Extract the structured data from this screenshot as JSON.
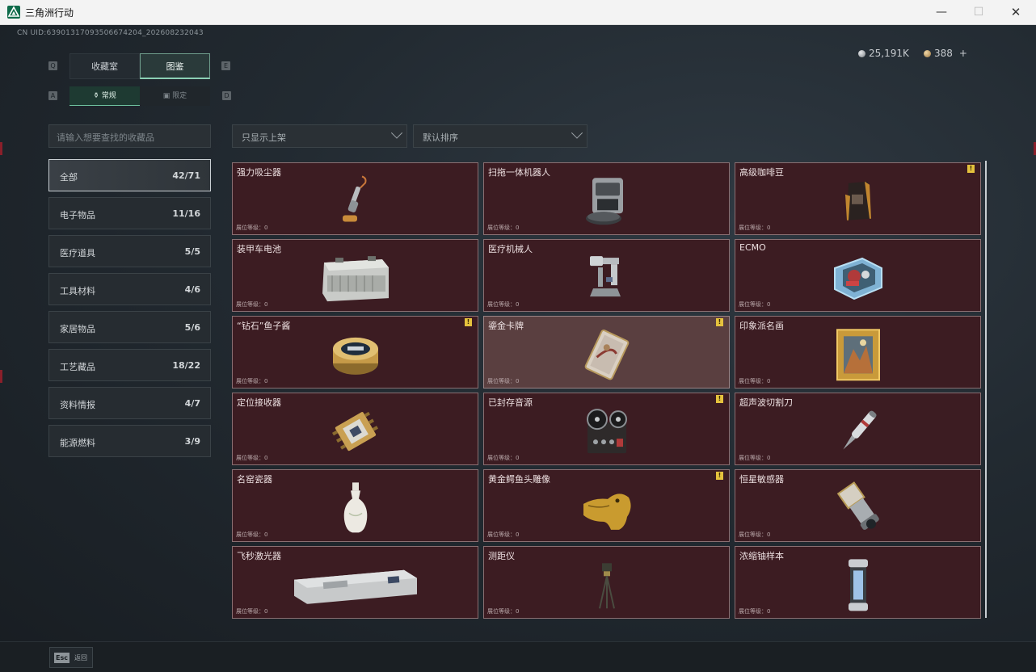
{
  "window": {
    "title": "三角洲行动",
    "minimize": "—",
    "maximize": "☐",
    "close": "✕"
  },
  "uid": "CN UID:63901317093506674204_202608232043",
  "currency": [
    {
      "icon": "silver-coin-icon",
      "value": "25,191K"
    },
    {
      "icon": "gold-coin-icon",
      "value": "388",
      "add": "+"
    }
  ],
  "key_hints": {
    "tab_prev": "Q",
    "tab_next": "E",
    "sub_prev": "A",
    "sub_next": "D"
  },
  "tabs": [
    {
      "label": "收藏室",
      "active": false
    },
    {
      "label": "图鉴",
      "active": true
    }
  ],
  "subtabs": [
    {
      "label": "常规",
      "active": true
    },
    {
      "label": "限定",
      "active": false
    }
  ],
  "search": {
    "placeholder": "请输入想要查找的收藏品"
  },
  "filters": {
    "shelf": "只显示上架",
    "sort": "默认排序"
  },
  "categories": [
    {
      "label": "全部",
      "count": "42/71",
      "active": true
    },
    {
      "label": "电子物品",
      "count": "11/16"
    },
    {
      "label": "医疗道具",
      "count": "5/5"
    },
    {
      "label": "工具材料",
      "count": "4/6"
    },
    {
      "label": "家居物品",
      "count": "5/6"
    },
    {
      "label": "工艺藏品",
      "count": "18/22"
    },
    {
      "label": "资料情报",
      "count": "4/7"
    },
    {
      "label": "能源燃料",
      "count": "3/9"
    }
  ],
  "items": [
    {
      "name": "强力吸尘器",
      "level": "展位等级：0",
      "alert": false,
      "icon": "vacuum-cleaner-icon"
    },
    {
      "name": "扫拖一体机器人",
      "level": "展位等级：0",
      "alert": false,
      "icon": "mop-robot-icon"
    },
    {
      "name": "高级咖啡豆",
      "level": "展位等级：0",
      "alert": true,
      "icon": "coffee-bag-icon"
    },
    {
      "name": "装甲车电池",
      "level": "展位等级：0",
      "alert": false,
      "icon": "vehicle-battery-icon"
    },
    {
      "name": "医疗机械人",
      "level": "展位等级：0",
      "alert": false,
      "icon": "medical-robot-icon"
    },
    {
      "name": "ECMO",
      "level": "展位等级：0",
      "alert": false,
      "icon": "ecmo-machine-icon"
    },
    {
      "name": "“钻石”鱼子酱",
      "level": "展位等级：0",
      "alert": true,
      "icon": "caviar-tin-icon"
    },
    {
      "name": "鎏金卡牌",
      "level": "展位等级：0",
      "alert": true,
      "highlight": true,
      "icon": "gilded-card-icon"
    },
    {
      "name": "印象派名画",
      "level": "展位等级：0",
      "alert": false,
      "icon": "framed-painting-icon"
    },
    {
      "name": "定位接收器",
      "level": "展位等级：0",
      "alert": false,
      "icon": "gps-receiver-icon"
    },
    {
      "name": "已封存音源",
      "level": "展位等级：0",
      "alert": true,
      "icon": "tape-recorder-icon"
    },
    {
      "name": "超声波切割刀",
      "level": "展位等级：0",
      "alert": false,
      "icon": "ultrasonic-knife-icon"
    },
    {
      "name": "名窑瓷器",
      "level": "展位等级：0",
      "alert": false,
      "icon": "porcelain-vase-icon"
    },
    {
      "name": "黄金鳄鱼头雕像",
      "level": "展位等级：0",
      "alert": true,
      "icon": "gold-crocodile-icon"
    },
    {
      "name": "恒星敏感器",
      "level": "展位等级：0",
      "alert": false,
      "icon": "star-sensor-icon"
    },
    {
      "name": "飞秒激光器",
      "level": "展位等级：0",
      "alert": false,
      "icon": "laser-case-icon"
    },
    {
      "name": "测距仪",
      "level": "展位等级：0",
      "alert": false,
      "icon": "rangefinder-tripod-icon"
    },
    {
      "name": "浓缩铀样本",
      "level": "展位等级：0",
      "alert": false,
      "icon": "uranium-canister-icon"
    }
  ],
  "bottom": {
    "esc_key": "Esc",
    "esc_label": "返回"
  }
}
